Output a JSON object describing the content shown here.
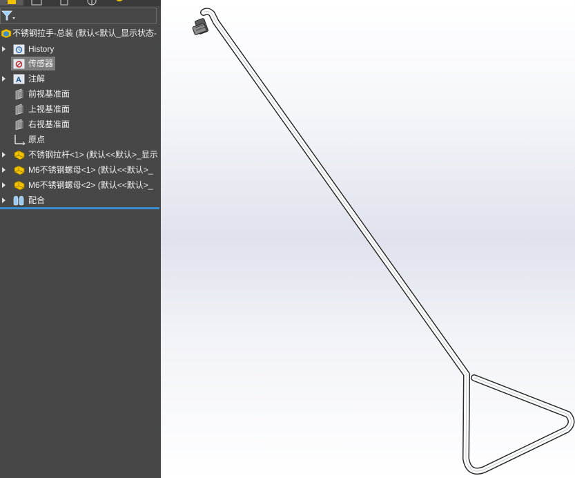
{
  "feature_tree": {
    "root_label": "不锈钢拉手-总装  (默认<默认_显示状态-",
    "items": [
      {
        "label": "History",
        "icon": "history-icon",
        "expandable": true
      },
      {
        "label": "传感器",
        "icon": "sensor-icon",
        "expandable": false,
        "selected": true
      },
      {
        "label": "注解",
        "icon": "annotation-icon",
        "expandable": true
      },
      {
        "label": "前视基准面",
        "icon": "plane-icon",
        "expandable": false
      },
      {
        "label": "上视基准面",
        "icon": "plane-icon",
        "expandable": false
      },
      {
        "label": "右视基准面",
        "icon": "plane-icon",
        "expandable": false
      },
      {
        "label": "原点",
        "icon": "origin-icon",
        "expandable": false
      },
      {
        "label": "不锈钢拉杆<1> (默认<<默认>_显示",
        "icon": "part-icon",
        "expandable": true
      },
      {
        "label": "M6不锈钢螺母<1> (默认<<默认>_",
        "icon": "part-icon",
        "expandable": true
      },
      {
        "label": "M6不锈钢螺母<2> (默认<<默认>_",
        "icon": "part-icon",
        "expandable": true
      },
      {
        "label": "配合",
        "icon": "mates-icon",
        "expandable": true
      }
    ]
  },
  "colors": {
    "panel_bg": "#474747",
    "accent_blue": "#3a8fd0",
    "part_yellow": "#f2c200"
  }
}
